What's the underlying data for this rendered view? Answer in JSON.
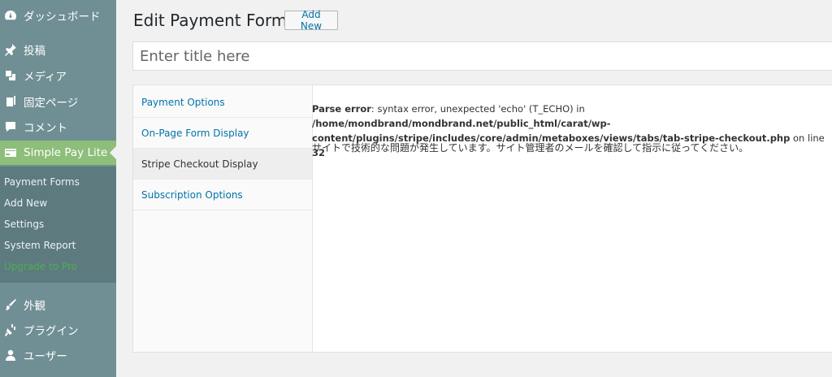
{
  "sidebar": {
    "items": [
      {
        "label": "ダッシュボード",
        "icon": "dashboard-icon"
      },
      {
        "label": "投稿",
        "icon": "pin-icon"
      },
      {
        "label": "メディア",
        "icon": "media-icon"
      },
      {
        "label": "固定ページ",
        "icon": "page-icon"
      },
      {
        "label": "コメント",
        "icon": "comment-icon"
      },
      {
        "label": "Simple Pay Lite",
        "icon": "payment-card-icon"
      },
      {
        "label": "外観",
        "icon": "appearance-brush-icon"
      },
      {
        "label": "プラグイン",
        "icon": "plugin-icon"
      },
      {
        "label": "ユーザー",
        "icon": "user-icon"
      }
    ],
    "submenu": [
      {
        "label": "Payment Forms"
      },
      {
        "label": "Add New"
      },
      {
        "label": "Settings"
      },
      {
        "label": "System Report"
      },
      {
        "label": "Upgrade to Pro"
      }
    ]
  },
  "header": {
    "title": "Edit Payment Form",
    "add_new_label": "Add New"
  },
  "title_input": {
    "placeholder": "Enter title here",
    "value": ""
  },
  "tabs": [
    {
      "label": "Payment Options"
    },
    {
      "label": "On-Page Form Display"
    },
    {
      "label": "Stripe Checkout Display"
    },
    {
      "label": "Subscription Options"
    }
  ],
  "panel": {
    "error_label": "Parse error",
    "error_message": ": syntax error, unexpected 'echo' (T_ECHO) in ",
    "error_path": "/home/mondbrand/mondbrand.net/public_html/carat/wp-content/plugins/stripe/includes/core/admin/metaboxes/views/tabs/tab-stripe-checkout.php",
    "error_on_line": " on line ",
    "error_line_number": "32",
    "site_message": "サイトで技術的な問題が発生しています。サイト管理者のメールを確認して指示に従ってください。"
  },
  "colors": {
    "sidebar_bg": "#6f8f94",
    "submenu_bg": "#5d7a7f",
    "current_menu_bg": "#8dbe7a",
    "link": "#0073aa",
    "upgrade": "#4caf50"
  }
}
